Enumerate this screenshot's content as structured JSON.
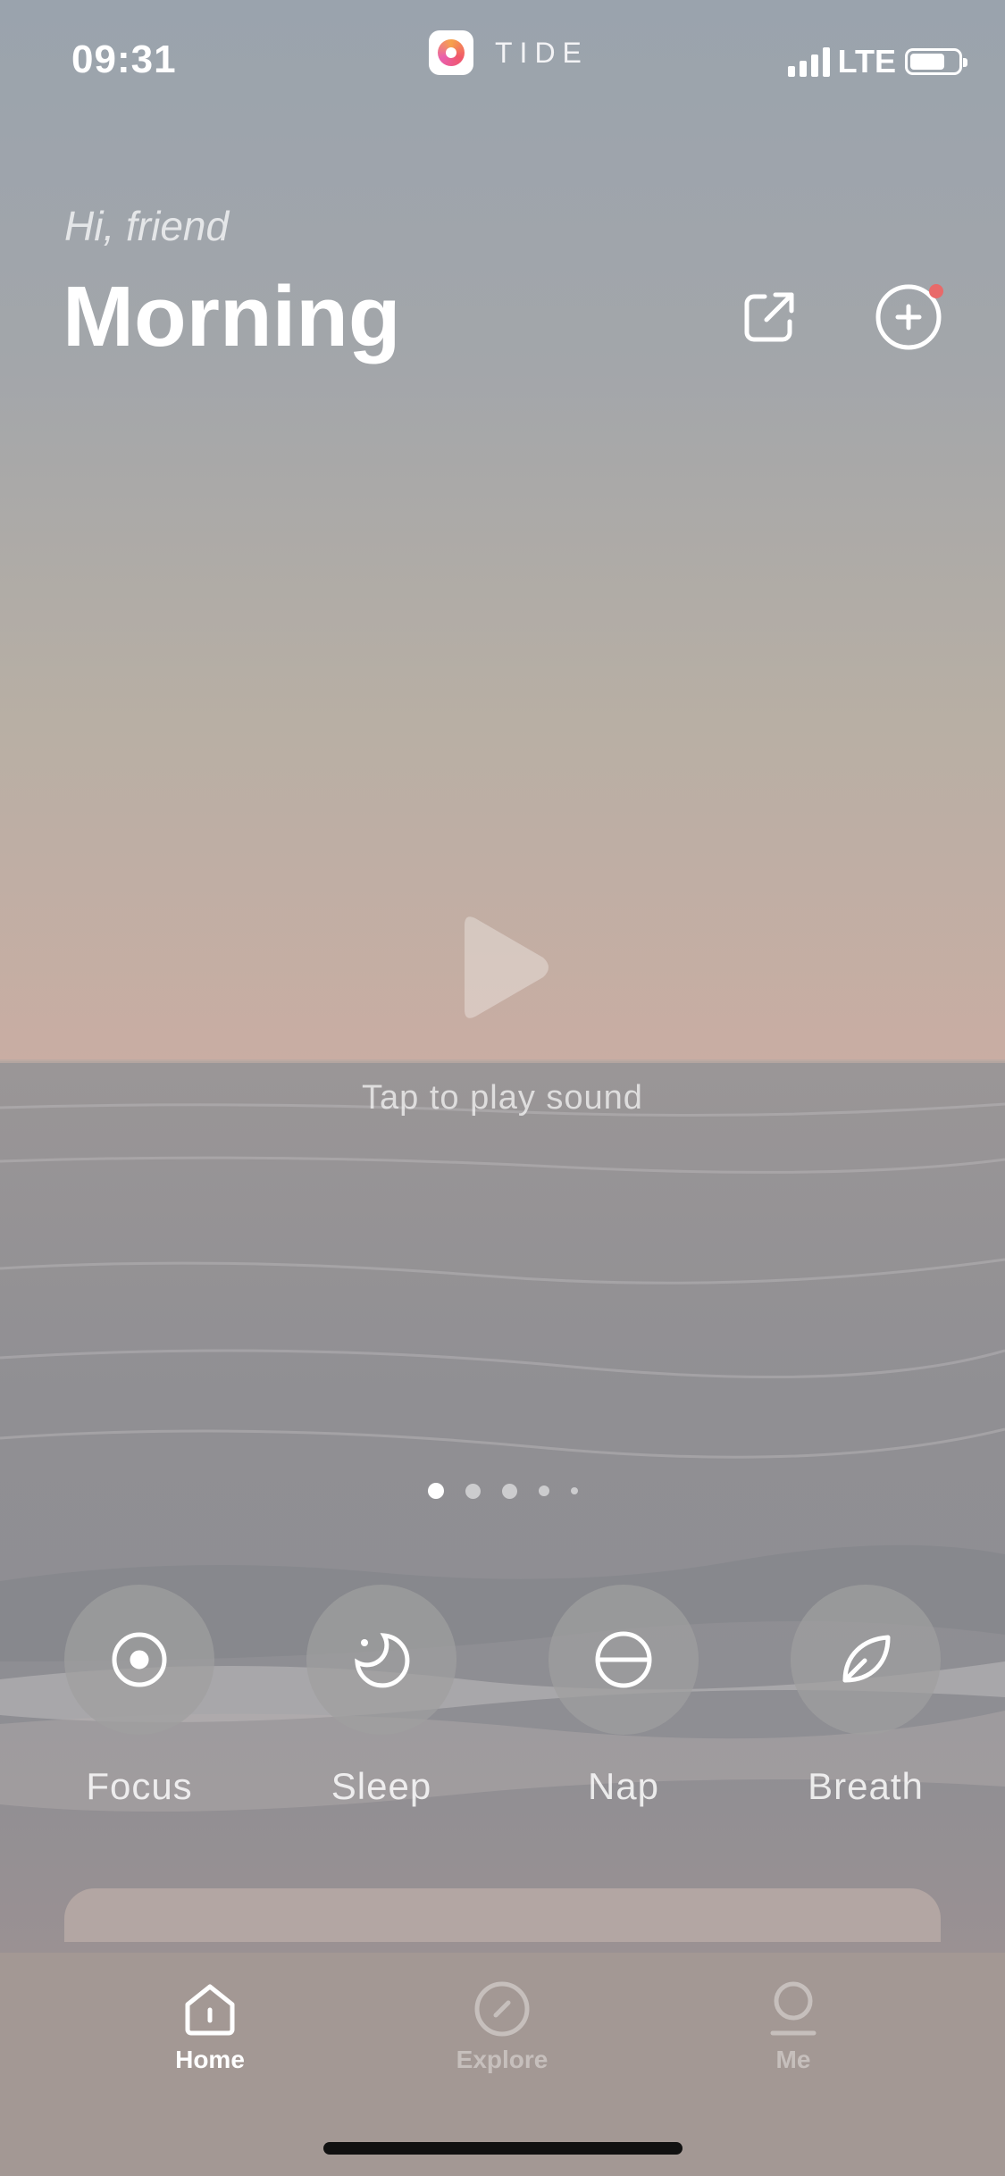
{
  "status_bar": {
    "time": "09:31",
    "app_name": "TIDE",
    "network": "LTE",
    "signal_bars_filled": 4,
    "battery_level": 0.7
  },
  "header": {
    "greeting": "Hi, friend",
    "title": "Morning",
    "share_icon": "share-external-icon",
    "add_icon": "plus-circle-icon",
    "has_notification": true
  },
  "player": {
    "icon": "play-icon",
    "caption": "Tap to play sound"
  },
  "pager": {
    "pages": 5,
    "active_index": 0
  },
  "modes": [
    {
      "label": "Focus",
      "icon": "target-icon"
    },
    {
      "label": "Sleep",
      "icon": "moon-icon"
    },
    {
      "label": "Nap",
      "icon": "half-circle-icon"
    },
    {
      "label": "Breath",
      "icon": "leaf-icon"
    }
  ],
  "tabbar": {
    "items": [
      {
        "label": "Home",
        "icon": "home-icon",
        "active": true
      },
      {
        "label": "Explore",
        "icon": "compass-icon",
        "active": false
      },
      {
        "label": "Me",
        "icon": "person-icon",
        "active": false
      }
    ]
  },
  "colors": {
    "sky_top": "#9aa3ad",
    "horizon": "#c7aea3",
    "sea": "#8f9298",
    "sand": "#a89c99",
    "notification": "#e86a6a",
    "tabbar": "#a39894"
  }
}
